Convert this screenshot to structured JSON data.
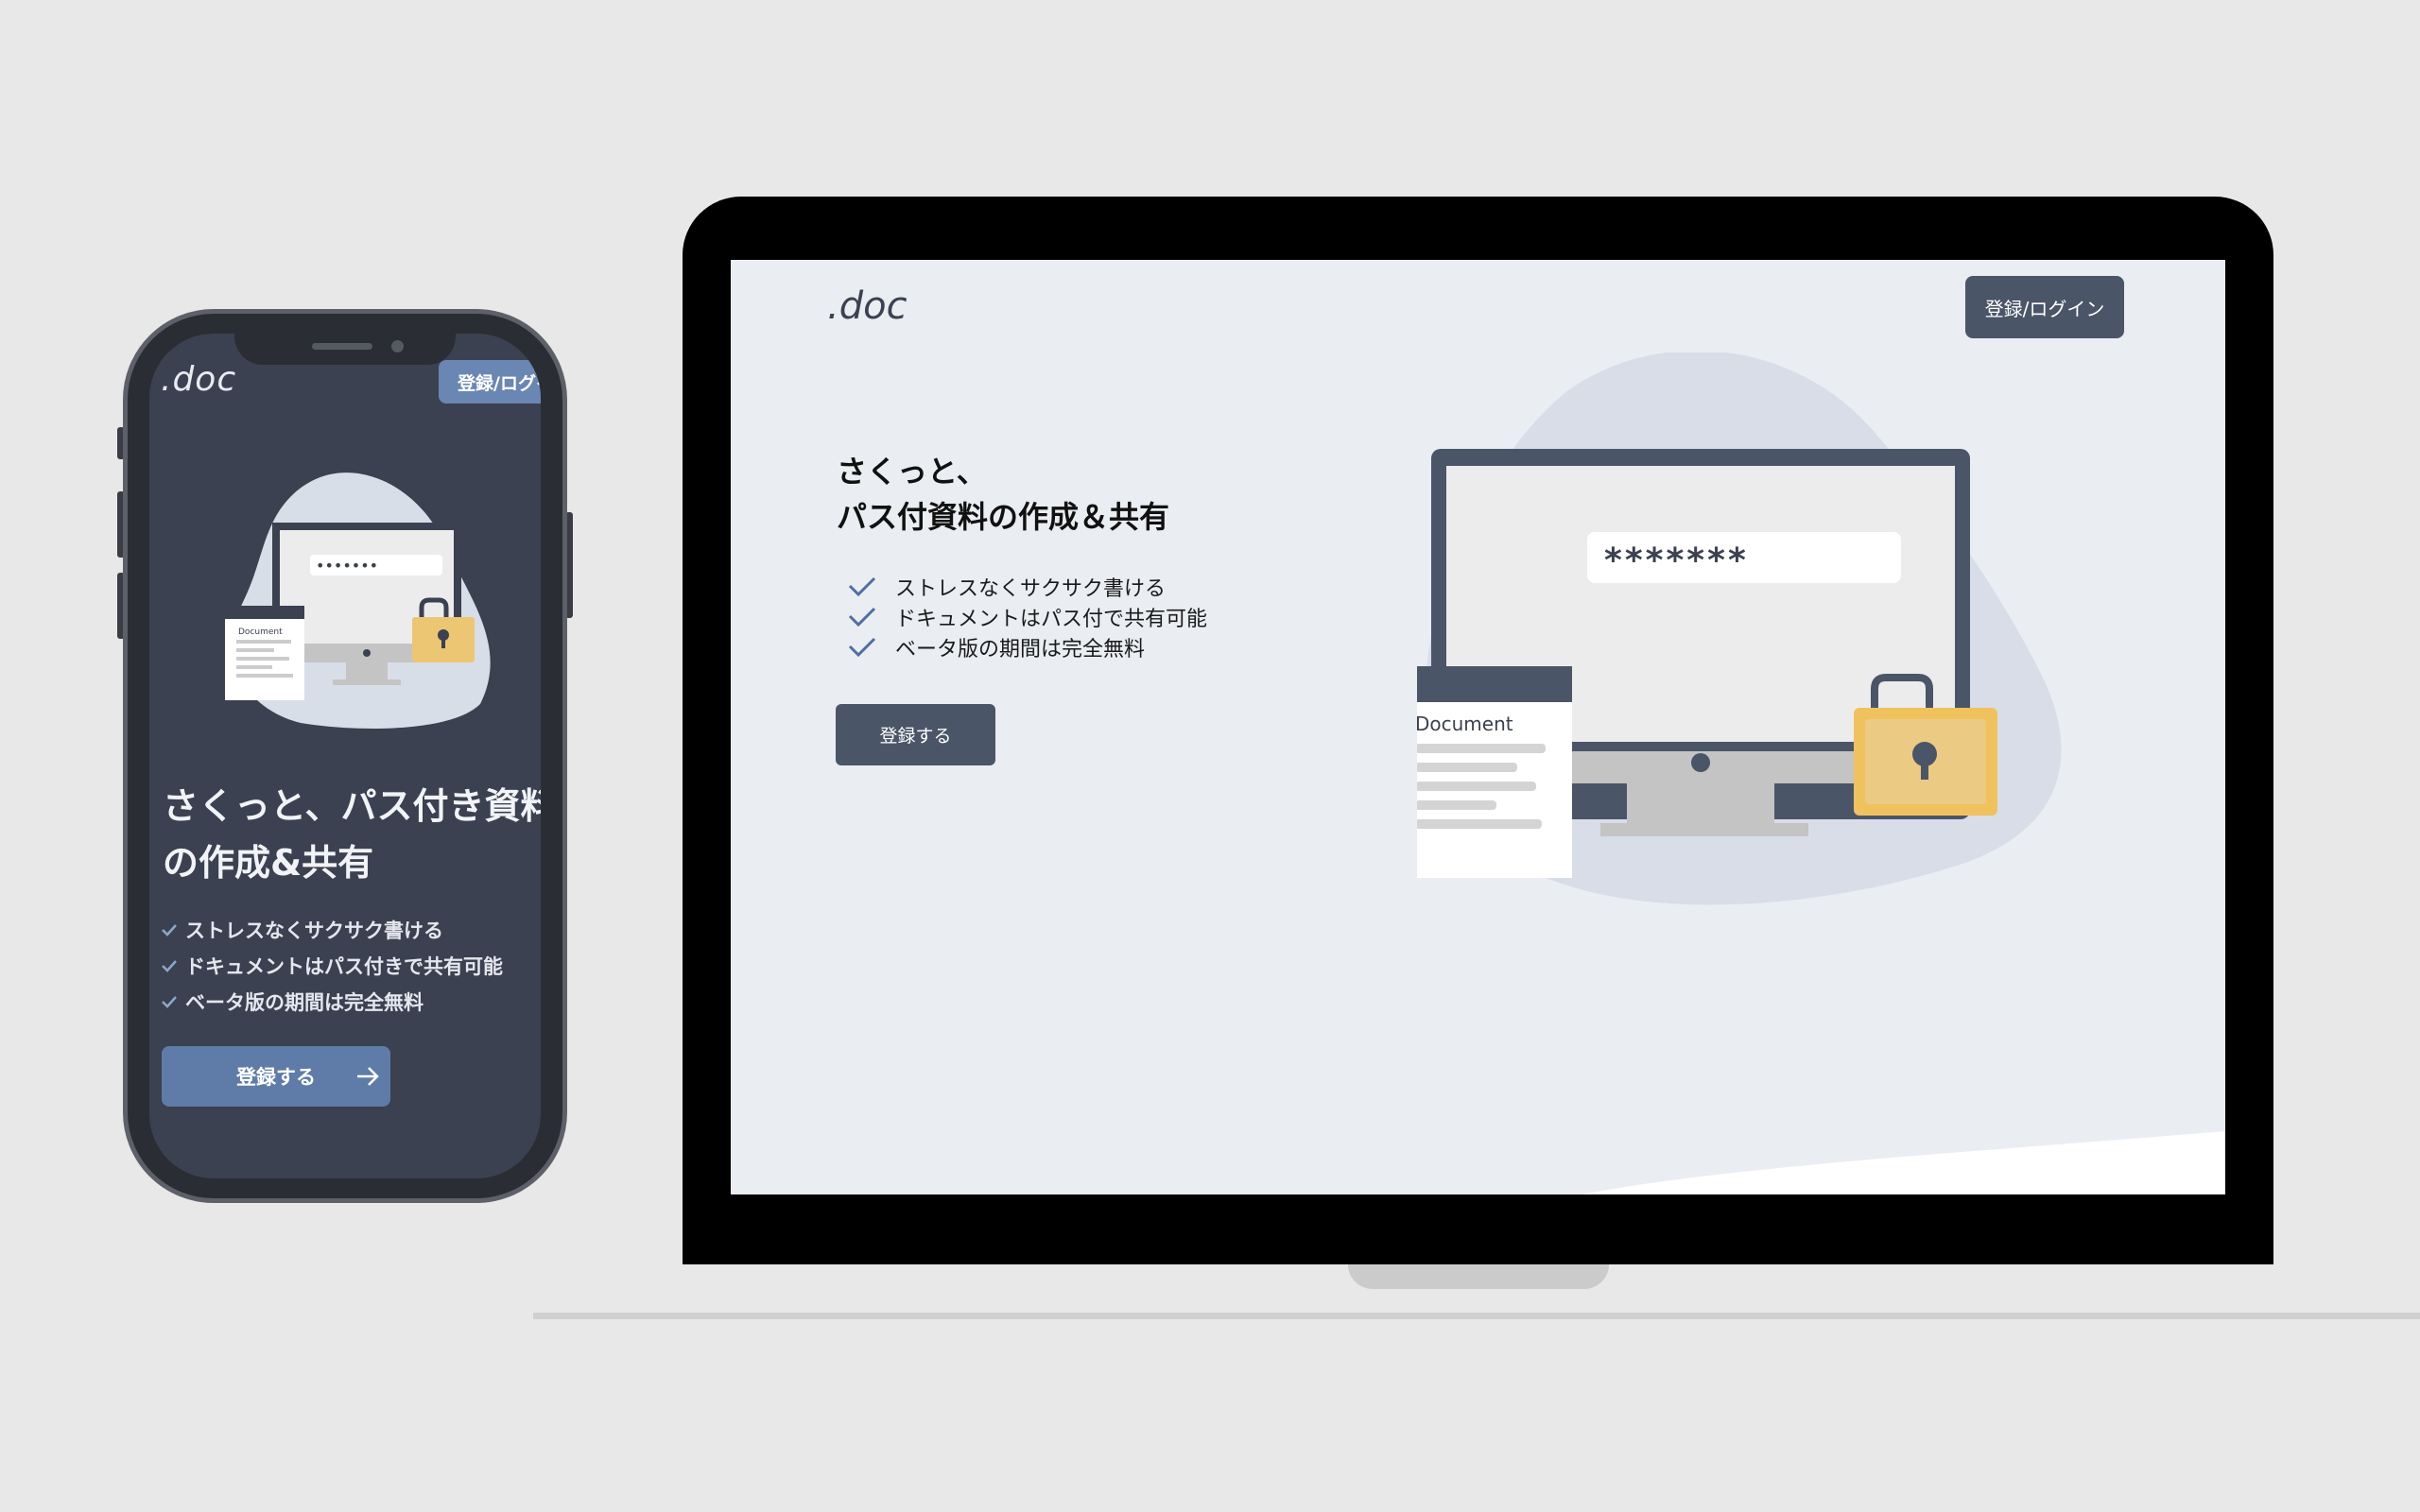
{
  "colors": {
    "background": "#e8e8e8",
    "phone_screen": "#3b4150",
    "laptop_screen": "#eaedf2",
    "primary_dark": "#4b5568",
    "accent_blue": "#5f7ca8",
    "lock_yellow": "#ecc672"
  },
  "mobile": {
    "logo": ".doc",
    "login_button": "登録/ログイン",
    "headline_line1": "さくっと、パス付き資料",
    "headline_line2": "の作成&共有",
    "features": [
      "ストレスなくサクサク書ける",
      "ドキュメントはパス付きで共有可能",
      "ベータ版の期間は完全無料"
    ],
    "cta": "登録する",
    "password_mask": "•••••••",
    "doc_label": "Document"
  },
  "desktop": {
    "logo": ".doc",
    "login_button": "登録/ログイン",
    "headline_line1": "さくっと、",
    "headline_line2": "パス付資料の作成＆共有",
    "features": [
      "ストレスなくサクサク書ける",
      "ドキュメントはパス付で共有可能",
      "ベータ版の期間は完全無料"
    ],
    "cta": "登録する",
    "password_mask": "*******",
    "doc_label": "Document"
  }
}
